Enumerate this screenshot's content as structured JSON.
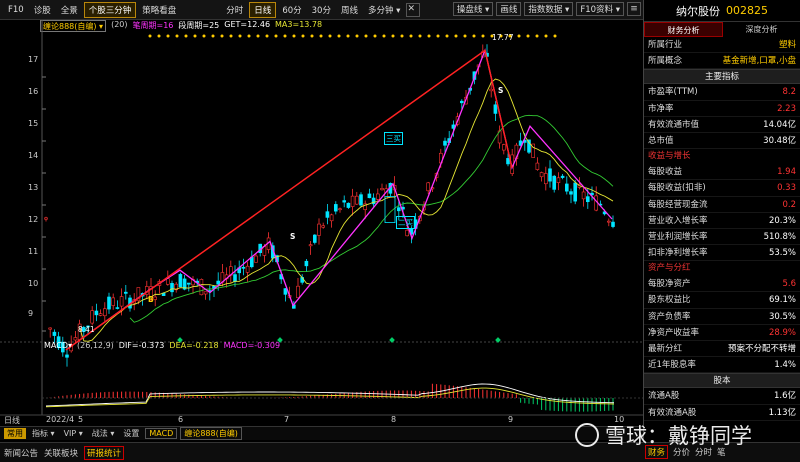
{
  "topbar": {
    "tabs": [
      "F10",
      "诊股",
      "全景",
      "个股三分钟",
      "策略看盘"
    ],
    "active_tab": "个股三分钟",
    "periods": [
      "分时",
      "日线",
      "60分",
      "30分",
      "周线",
      "多分钟 ▾"
    ],
    "active_period": "日线",
    "right": [
      "操盘线 ▾",
      "画线",
      "指数数据 ▾",
      "F10资料 ▾"
    ]
  },
  "infobar": {
    "indicator": "缠论888(自编) ▾",
    "param": "(20)",
    "bi_period": "笔周期=16",
    "duan_period": "段周期=25",
    "get": "GET=12.46",
    "ma3": "MA3=13.78"
  },
  "yaxis": [
    "17",
    "16",
    "15",
    "14",
    "13",
    "12",
    "11",
    "10",
    "9"
  ],
  "xaxis": [
    "日线",
    "2022/4",
    "5",
    "6",
    "7",
    "8",
    "9",
    "10"
  ],
  "annotations": {
    "high": "17.77",
    "low": "8.41",
    "three_buy_1": "三买",
    "three_buy_2": "二买",
    "s1": "S",
    "s2": "S",
    "buy_b": "B"
  },
  "macd": {
    "name": "MACD▾",
    "params": "(26,12,9)",
    "dif": "DIF=-0.373",
    "dea": "DEA=-0.218",
    "macd": "MACD=-0.309"
  },
  "bottombar": [
    "常用",
    "指标 ▾",
    "VIP ▾",
    "战法 ▾",
    "设置",
    "MACD",
    "缠论888(自编)"
  ],
  "bottombar_selected": "常用",
  "footer": [
    "新闻公告",
    "关联板块",
    "研报统计"
  ],
  "footer_selected": "研报统计",
  "panel": {
    "name": "纳尔股份",
    "code": "002825",
    "tabs": [
      "财务分析",
      "深度分析"
    ],
    "industry_label": "所属行业",
    "industry": "塑料",
    "concept_label": "所属概念",
    "concept": "基金新增,口罩,小盘",
    "key_section": "主要指标",
    "key_rows": [
      {
        "label": "市盈率(TTM)",
        "value": "8.2"
      },
      {
        "label": "市净率",
        "value": "2.23"
      },
      {
        "label": "有效流通市值",
        "value": "14.04亿"
      },
      {
        "label": "总市值",
        "value": "30.48亿"
      }
    ],
    "growth_sub": "收益与增长",
    "growth_rows": [
      {
        "label": "每股收益",
        "value": "1.94"
      },
      {
        "label": "每股收益(扣非)",
        "value": "0.33"
      },
      {
        "label": "每股经营现金流",
        "value": "0.2"
      },
      {
        "label": "营业收入增长率",
        "value": "20.3%"
      },
      {
        "label": "营业利润增长率",
        "value": "510.8%"
      },
      {
        "label": "扣非净利增长率",
        "value": "53.5%"
      }
    ],
    "asset_sub": "资产与分红",
    "asset_rows": [
      {
        "label": "每股净资产",
        "value": "5.6"
      },
      {
        "label": "股东权益比",
        "value": "69.1%"
      },
      {
        "label": "资产负债率",
        "value": "30.5%"
      },
      {
        "label": "净资产收益率",
        "value": "28.9%"
      },
      {
        "label": "最新分红",
        "value": "预案不分配不转增"
      },
      {
        "label": "近1年股息率",
        "value": "1.4%"
      }
    ],
    "share_section": "股本",
    "share_rows": [
      {
        "label": "流通A股",
        "value": "1.6亿"
      },
      {
        "label": "有效流通A股",
        "value": "1.13亿"
      }
    ],
    "bottom_tabs": [
      "财务",
      "分价",
      "分时",
      "笔"
    ]
  },
  "watermark": "雪球：戴铮同学",
  "colors": {
    "up": "#ff3333",
    "down": "#00e5ff",
    "bi": "#ff33ff",
    "duan": "#ff2222",
    "ma": "#33cc33",
    "ma2": "#e6e633"
  }
}
